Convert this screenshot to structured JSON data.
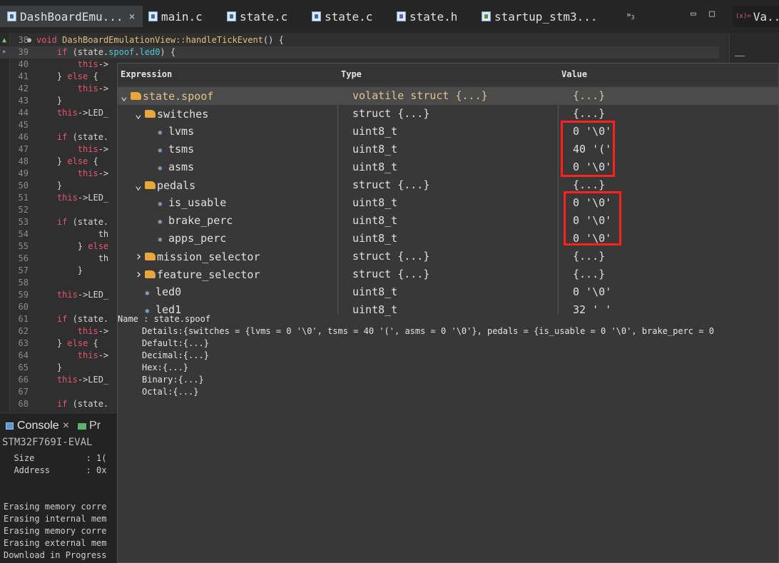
{
  "tabs": [
    {
      "label": "DashBoardEmu...",
      "icon": "c-file-icon",
      "active": true
    },
    {
      "label": "main.c",
      "icon": "c-file-icon"
    },
    {
      "label": "state.c",
      "icon": "c-file-icon"
    },
    {
      "label": "state.c",
      "icon": "c-file-icon"
    },
    {
      "label": "state.h",
      "icon": "h-file-icon"
    },
    {
      "label": "startup_stm3...",
      "icon": "s-file-icon"
    }
  ],
  "tab_close_glyph": "×",
  "overflow_label": "»",
  "overflow_count": "3",
  "variables_tab": "Va...",
  "editor": {
    "lines": [
      {
        "n": "38",
        "code": "void DashBoardEmulationView::handleTickEvent() {"
      },
      {
        "n": "39",
        "code": "    if (state.spoof.led0) {"
      },
      {
        "n": "40",
        "code": "        this->"
      },
      {
        "n": "41",
        "code": "    } else {"
      },
      {
        "n": "42",
        "code": "        this->"
      },
      {
        "n": "43",
        "code": "    }"
      },
      {
        "n": "44",
        "code": "    this->LED_"
      },
      {
        "n": "45",
        "code": ""
      },
      {
        "n": "46",
        "code": "    if (state."
      },
      {
        "n": "47",
        "code": "        this->"
      },
      {
        "n": "48",
        "code": "    } else {"
      },
      {
        "n": "49",
        "code": "        this->"
      },
      {
        "n": "50",
        "code": "    }"
      },
      {
        "n": "51",
        "code": "    this->LED_"
      },
      {
        "n": "52",
        "code": ""
      },
      {
        "n": "53",
        "code": "    if (state."
      },
      {
        "n": "54",
        "code": "            th"
      },
      {
        "n": "55",
        "code": "        } else"
      },
      {
        "n": "56",
        "code": "            th"
      },
      {
        "n": "57",
        "code": "        }"
      },
      {
        "n": "58",
        "code": ""
      },
      {
        "n": "59",
        "code": "    this->LED_"
      },
      {
        "n": "60",
        "code": ""
      },
      {
        "n": "61",
        "code": "    if (state."
      },
      {
        "n": "62",
        "code": "        this->"
      },
      {
        "n": "63",
        "code": "    } else {"
      },
      {
        "n": "64",
        "code": "        this->"
      },
      {
        "n": "65",
        "code": "    }"
      },
      {
        "n": "66",
        "code": "    this->LED_"
      },
      {
        "n": "67",
        "code": ""
      },
      {
        "n": "68",
        "code": "    if (state."
      }
    ]
  },
  "console": {
    "tab_label": "Console",
    "close_glyph": "×",
    "second_tab": "Pr",
    "device": "STM32F769I-EVAL",
    "lines": [
      "  Size          : 1(",
      "  Address       : 0x",
      "",
      "",
      "Erasing memory corre",
      "Erasing internal mem",
      "Erasing memory corre",
      "Erasing external mem",
      "Download in Progress"
    ]
  },
  "popup": {
    "headers": {
      "expression": "Expression",
      "type": "Type",
      "value": "Value"
    },
    "rows": [
      {
        "expr": "state.spoof",
        "type": "volatile struct {...}",
        "value": "{...}",
        "indent": 0,
        "arrow": "v",
        "kind": "struct",
        "selected": true
      },
      {
        "expr": "switches",
        "type": "struct {...}",
        "value": "{...}",
        "indent": 1,
        "arrow": "v",
        "kind": "struct"
      },
      {
        "expr": "lvms",
        "type": "uint8_t",
        "value": "0 '\\0'",
        "indent": 2,
        "kind": "field"
      },
      {
        "expr": "tsms",
        "type": "uint8_t",
        "value": "40 '('",
        "indent": 2,
        "kind": "field"
      },
      {
        "expr": "asms",
        "type": "uint8_t",
        "value": "0 '\\0'",
        "indent": 2,
        "kind": "field"
      },
      {
        "expr": "pedals",
        "type": "struct {...}",
        "value": "{...}",
        "indent": 1,
        "arrow": "v",
        "kind": "struct"
      },
      {
        "expr": "is_usable",
        "type": "uint8_t",
        "value": "0 '\\0'",
        "indent": 2,
        "kind": "field"
      },
      {
        "expr": "brake_perc",
        "type": "uint8_t",
        "value": "0 '\\0'",
        "indent": 2,
        "kind": "field"
      },
      {
        "expr": "apps_perc",
        "type": "uint8_t",
        "value": "0 '\\0'",
        "indent": 2,
        "kind": "field"
      },
      {
        "expr": "mission_selector",
        "type": "struct {...}",
        "value": "{...}",
        "indent": 1,
        "arrow": ">",
        "kind": "struct"
      },
      {
        "expr": "feature_selector",
        "type": "struct {...}",
        "value": "{...}",
        "indent": 1,
        "arrow": ">",
        "kind": "struct"
      },
      {
        "expr": "led0",
        "type": "uint8_t",
        "value": "0 '\\0'",
        "indent": 1,
        "kind": "field"
      },
      {
        "expr": "led1",
        "type": "uint8_t",
        "value": "32 ' '",
        "indent": 1,
        "kind": "field"
      }
    ],
    "details": {
      "name": "Name : state.spoof",
      "details": "Details:{switches = {lvms = 0 '\\0', tsms = 40 '(', asms = 0 '\\0'}, pedals = {is_usable = 0 '\\0', brake_perc = 0",
      "default": "Default:{...}",
      "decimal": "Decimal:{...}",
      "hex": "Hex:{...}",
      "binary": "Binary:{...}",
      "octal": "Octal:{...}"
    }
  },
  "colors": {
    "highlight_box": "#ff1f1f",
    "selected_row_text": "#e0c48a",
    "keyword": "#e8566b"
  }
}
